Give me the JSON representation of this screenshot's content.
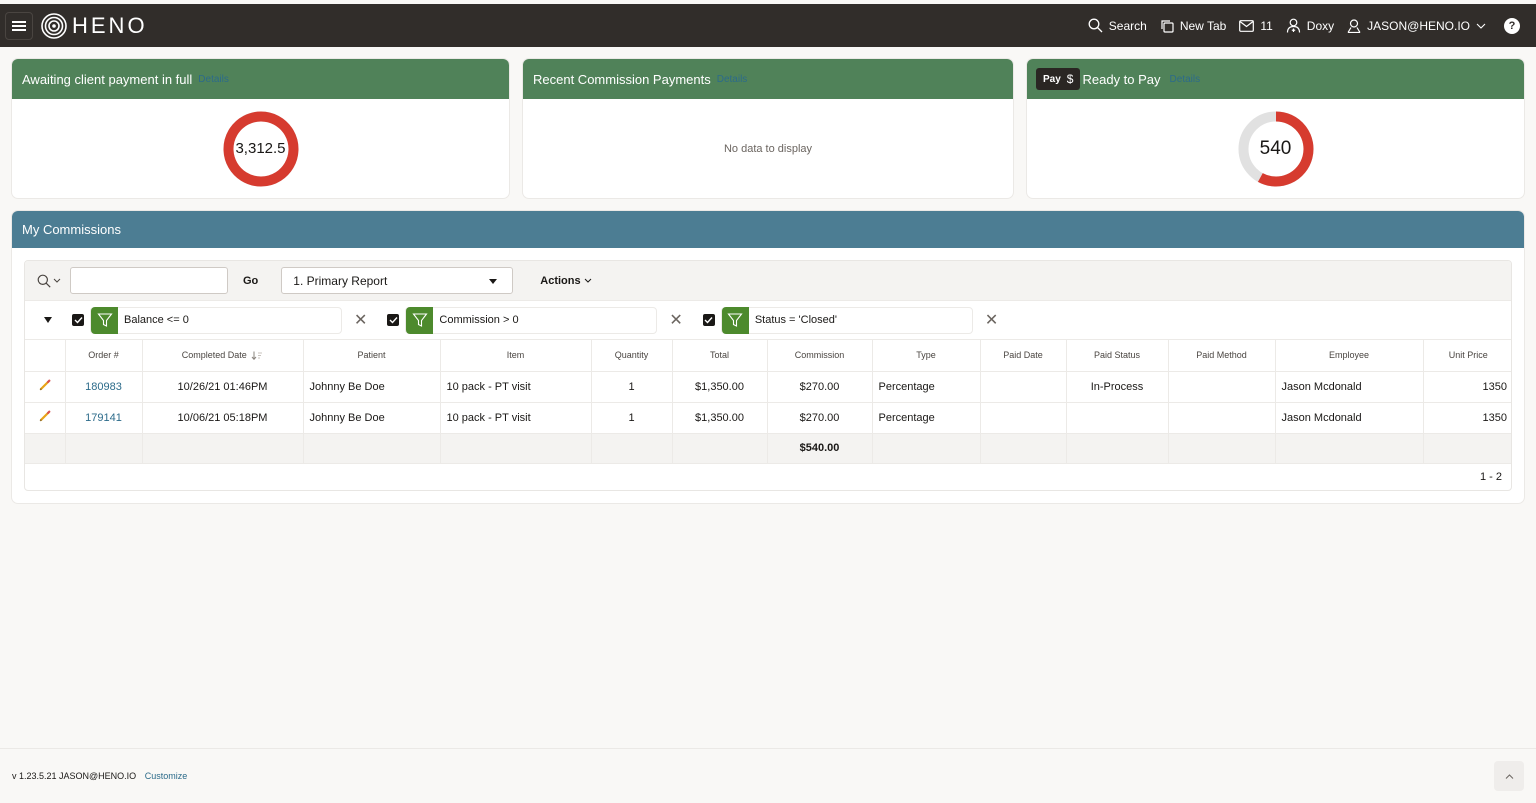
{
  "header": {
    "brand": "HENO",
    "nav": {
      "search": "Search",
      "new_tab": "New Tab",
      "messages_count": "11",
      "doxy": "Doxy",
      "user": "JASON@HENO.IO",
      "help": "?"
    }
  },
  "cards": [
    {
      "title": "Awaiting client payment in full",
      "details_link": "Details",
      "value_label": "3,312.5",
      "gauge_fraction": 1.0,
      "color": "#d63b2f"
    },
    {
      "title": "Recent Commission Payments",
      "details_link": "Details",
      "empty_message": "No data to display"
    },
    {
      "title": "Ready to Pay",
      "details_link": "Details",
      "pay_button": "Pay",
      "pay_icon": "$",
      "value_label": "540",
      "gauge_fraction": 0.58,
      "color": "#d63b2f",
      "track_color": "#e1e1e1"
    }
  ],
  "commissions": {
    "title": "My Commissions",
    "toolbar": {
      "search_value": "",
      "go_label": "Go",
      "report_selected": "1. Primary Report",
      "actions_label": "Actions"
    },
    "filters": [
      {
        "label": "Balance <= 0",
        "checked": true
      },
      {
        "label": "Commission > 0",
        "checked": true
      },
      {
        "label": "Status = 'Closed'",
        "checked": true
      }
    ],
    "columns": [
      "",
      "Order #",
      "Completed Date",
      "Patient",
      "Item",
      "Quantity",
      "Total",
      "Commission",
      "Type",
      "Paid Date",
      "Paid Status",
      "Paid Method",
      "Employee",
      "Unit Price"
    ],
    "rows": [
      {
        "order": "180983",
        "completed_date": "10/26/21 01:46PM",
        "patient": "Johnny Be Doe",
        "item": "10 pack - PT visit",
        "quantity": "1",
        "total": "$1,350.00",
        "commission": "$270.00",
        "type": "Percentage",
        "paid_date": "",
        "paid_status": "In-Process",
        "paid_method": "",
        "employee": "Jason Mcdonald",
        "unit_price": "1350"
      },
      {
        "order": "179141",
        "completed_date": "10/06/21 05:18PM",
        "patient": "Johnny Be Doe",
        "item": "10 pack - PT visit",
        "quantity": "1",
        "total": "$1,350.00",
        "commission": "$270.00",
        "type": "Percentage",
        "paid_date": "",
        "paid_status": "",
        "paid_method": "",
        "employee": "Jason Mcdonald",
        "unit_price": "1350"
      }
    ],
    "commission_total": "$540.00",
    "pagination": "1 - 2"
  },
  "footer": {
    "version": "v 1.23.5.21 JASON@HENO.IO",
    "customize": "Customize"
  }
}
